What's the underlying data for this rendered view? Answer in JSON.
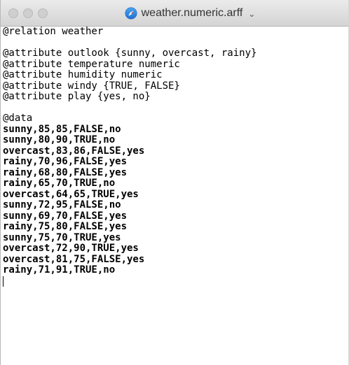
{
  "window": {
    "title": "weather.numeric.arff",
    "title_menu_icon": "chevron-down-icon",
    "document_icon": "compass-icon",
    "colors": {
      "titlebar": "#d9d9d9",
      "traffic_light_inactive": "#cfcfcf",
      "text": "#000000"
    }
  },
  "editor": {
    "lines": [
      "@relation weather",
      "",
      "@attribute outlook {sunny, overcast, rainy}",
      "@attribute temperature numeric",
      "@attribute humidity numeric",
      "@attribute windy {TRUE, FALSE}",
      "@attribute play {yes, no}",
      "",
      "@data",
      "sunny,85,85,FALSE,no",
      "sunny,80,90,TRUE,no",
      "overcast,83,86,FALSE,yes",
      "rainy,70,96,FALSE,yes",
      "rainy,68,80,FALSE,yes",
      "rainy,65,70,TRUE,no",
      "overcast,64,65,TRUE,yes",
      "sunny,72,95,FALSE,no",
      "sunny,69,70,FALSE,yes",
      "rainy,75,80,FALSE,yes",
      "sunny,75,70,TRUE,yes",
      "overcast,72,90,TRUE,yes",
      "overcast,81,75,FALSE,yes",
      "rainy,71,91,TRUE,no"
    ]
  }
}
